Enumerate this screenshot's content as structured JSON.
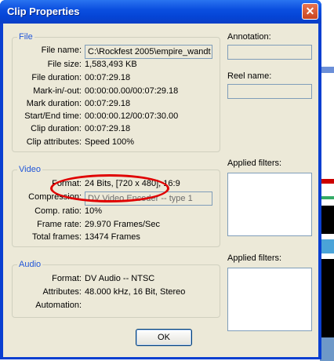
{
  "window": {
    "title": "Clip Properties",
    "close_glyph": "✕"
  },
  "file": {
    "group_title": "File",
    "rows": [
      {
        "label": "File name:",
        "value": "C:\\Rockfest 2005\\empire_wandt"
      },
      {
        "label": "File size:",
        "value": "1,583,493 KB"
      },
      {
        "label": "File duration:",
        "value": "00:07:29.18"
      },
      {
        "label": "Mark-in/-out:",
        "value": "00:00:00.00/00:07:29.18"
      },
      {
        "label": "Mark duration:",
        "value": "00:07:29.18"
      },
      {
        "label": "Start/End time:",
        "value": "00:00:00.12/00:07:30.00"
      },
      {
        "label": "Clip duration:",
        "value": "00:07:29.18"
      },
      {
        "label": "Clip attributes:",
        "value": "Speed 100%"
      }
    ]
  },
  "video": {
    "group_title": "Video",
    "rows": [
      {
        "label": "Format:",
        "value": "24 Bits, [720 x 480], 16:9"
      },
      {
        "label": "Compression:",
        "value": "DV Video Encoder -- type 1"
      },
      {
        "label": "Comp. ratio:",
        "value": "10%"
      },
      {
        "label": "Frame rate:",
        "value": "29.970 Frames/Sec"
      },
      {
        "label": "Total frames:",
        "value": "13474 Frames"
      }
    ]
  },
  "audio": {
    "group_title": "Audio",
    "rows": [
      {
        "label": "Format:",
        "value": "DV Audio -- NTSC"
      },
      {
        "label": "Attributes:",
        "value": "48.000 kHz, 16 Bit, Stereo"
      },
      {
        "label": "Automation:",
        "value": ""
      }
    ]
  },
  "right": {
    "annotation_label": "Annotation:",
    "reel_label": "Reel name:",
    "applied_filters_video_label": "Applied filters:",
    "applied_filters_audio_label": "Applied filters:"
  },
  "ok_label": "OK",
  "colors": {
    "titlebar": "#0b4fe0",
    "group_title": "#2156d8",
    "highlight_ellipse": "#e00000"
  }
}
